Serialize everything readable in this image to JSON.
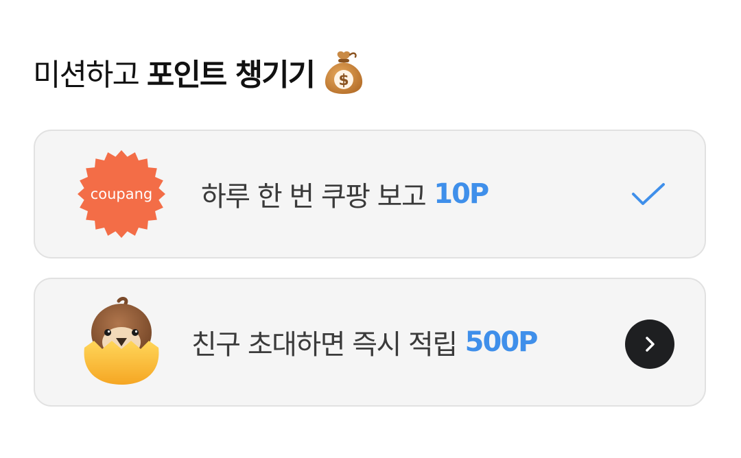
{
  "header": {
    "title_plain": "미션하고",
    "title_bold": "포인트 챙기기",
    "emoji_icon": "money-bag-icon"
  },
  "missions": [
    {
      "logo_text": "coupang",
      "logo_color": "#f36d47",
      "text": "하루 한 번 쿠팡 보고",
      "points": "10P",
      "status": "completed",
      "status_icon": "check-icon"
    },
    {
      "logo_icon": "chick-in-egg-icon",
      "text": "친구 초대하면 즉시 적립",
      "points": "500P",
      "status": "available",
      "status_icon": "chevron-right-icon"
    }
  ],
  "colors": {
    "points": "#3f8fea",
    "card_bg": "#f5f5f5",
    "card_border": "#e1e1e1",
    "arrow_button": "#1e1f21"
  }
}
